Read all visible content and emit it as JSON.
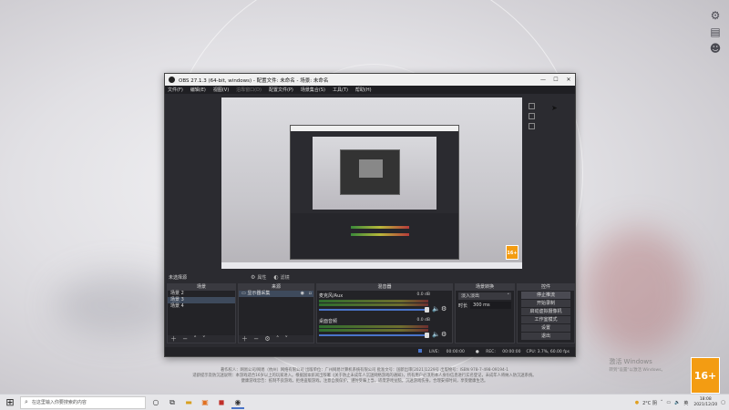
{
  "desktop": {
    "right_icons": [
      "settings-gear-icon",
      "book-reader-icon",
      "user-icon"
    ]
  },
  "obs": {
    "title": "OBS 27.1.3 (64-bit, windows) - 配置文件: 未命名 - 场景: 未命名",
    "menu": [
      "文件(F)",
      "编辑(E)",
      "视图(V)",
      "泊靠窗口(D)",
      "配置文件(P)",
      "场景集合(S)",
      "工具(T)",
      "帮助(H)"
    ],
    "no_source": "未选择源",
    "tool_props": "属性",
    "tool_filters": "滤镜",
    "docks": {
      "scenes": {
        "title": "场景",
        "items": [
          "场景 2",
          "场景 3",
          "场景 4"
        ],
        "selected_index": 1
      },
      "sources": {
        "title": "来源",
        "items": [
          "显示器采集"
        ]
      },
      "mixer": {
        "title": "混音器",
        "channels": [
          {
            "name": "麦克风/Aux",
            "db": "0.0 dB"
          },
          {
            "name": "桌面音频",
            "db": "0.0 dB"
          }
        ]
      },
      "transitions": {
        "title": "场景转换",
        "type": "淡入淡出",
        "duration_label": "时长",
        "duration_value": "300 ms"
      },
      "controls": {
        "title": "控件",
        "buttons": [
          "停止推流",
          "开始录制",
          "启动虚拟摄像机",
          "工作室模式",
          "设置",
          "退出"
        ]
      }
    },
    "status": {
      "live_label": "LIVE:",
      "live_time": "00:00:00",
      "rec_label": "REC:",
      "rec_time": "00:00:00",
      "cpu": "CPU: 3.7%, 60.00 fps"
    },
    "rating_badge": "16+"
  },
  "footer": {
    "line1": "著作权人：网易公司/网易（杭州）网络有限公司  出版单位：广州网易计算机系统有限公司  批准文号：国新出审[2021]1229号  出版物号：ISBN 978-7-498-09194-1",
    "line2": "适龄提示及防沉迷说明：本游戏适合16岁以上的玩家进入。根据国家新闻出版署《关于防止未成年人沉迷网络游戏的通知》，所有用户必须用本人身份信息进行实名登记，未成年人将纳入防沉迷系统。",
    "line3": "健康游戏忠告：抵制不良游戏，拒绝盗版游戏。注意自我保护，谨防受骗上当。适度游戏益脑，沉迷游戏伤身。合理安排时间，享受健康生活。"
  },
  "watermark": {
    "line1": "激活 Windows",
    "line2": "转到\"设置\"以激活 Windows。"
  },
  "rating_corner": "16+",
  "taskbar": {
    "search_placeholder": "在这里输入你要搜索的内容",
    "weather": "2°C 阴",
    "lang": "英",
    "time": "18:08",
    "date": "2021/12/20"
  }
}
